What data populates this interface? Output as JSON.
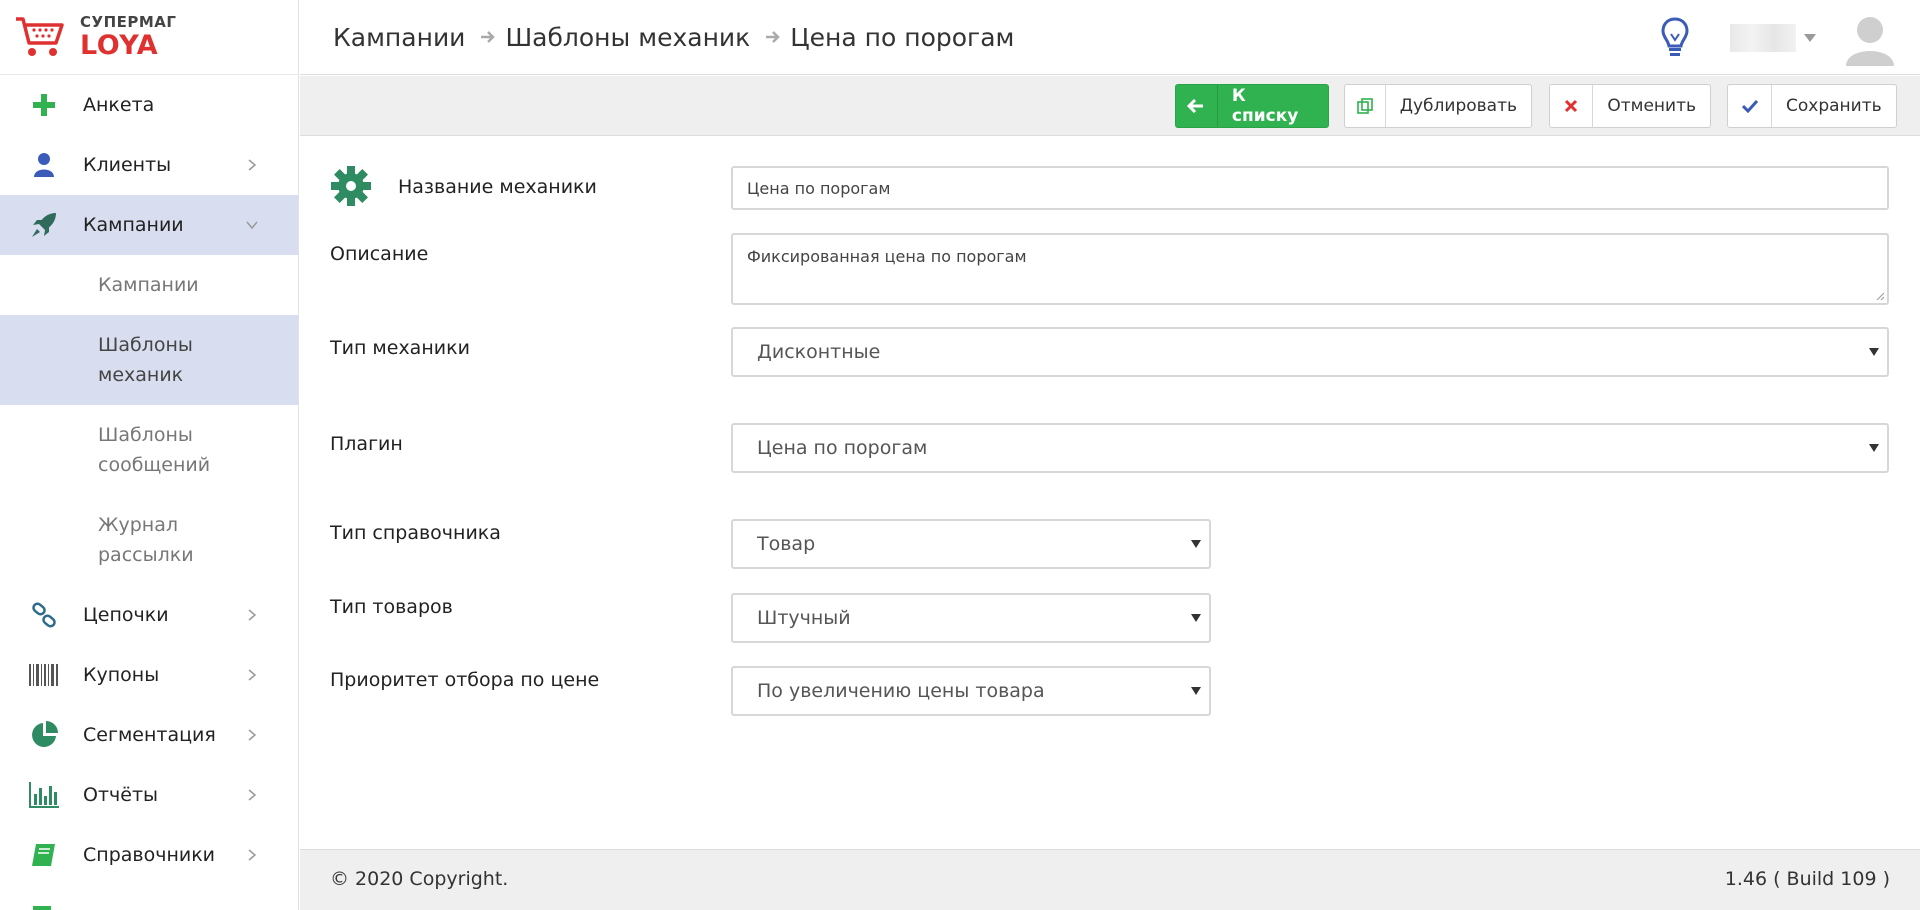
{
  "brand": {
    "top": "СУПЕРМАГ",
    "bottom": "LOYA"
  },
  "colors": {
    "accent_green": "#2fb24f",
    "active_nav": "#d8deef",
    "logo_red": "#e03131",
    "icon_teal": "#2e8b62",
    "icon_blue": "#3a5bb8"
  },
  "sidebar": {
    "items": [
      {
        "label": "Анкета",
        "icon": "plus-icon"
      },
      {
        "label": "Клиенты",
        "icon": "user-icon"
      },
      {
        "label": "Кампании",
        "icon": "rocket-icon"
      },
      {
        "label": "Цепочки",
        "icon": "chain-icon"
      },
      {
        "label": "Купоны",
        "icon": "barcode-icon"
      },
      {
        "label": "Сегментация",
        "icon": "pie-chart-icon"
      },
      {
        "label": "Отчёты",
        "icon": "bar-chart-icon"
      },
      {
        "label": "Справочники",
        "icon": "book-icon"
      }
    ],
    "sub_items": [
      {
        "label": "Кампании"
      },
      {
        "line1": "Шаблоны",
        "line2": "механик"
      },
      {
        "line1": "Шаблоны",
        "line2": "сообщений"
      },
      {
        "line1": "Журнал",
        "line2": "рассылки"
      }
    ]
  },
  "breadcrumb": [
    "Кампании",
    "Шаблоны механик",
    "Цена по порогам"
  ],
  "toolbar": {
    "back_label": "К списку",
    "duplicate_label": "Дублировать",
    "cancel_label": "Отменить",
    "save_label": "Сохранить"
  },
  "form": {
    "name_label": "Название механики",
    "name_value": "Цена по порогам",
    "description_label": "Описание",
    "description_value": "Фиксированная цена по порогам",
    "type_label": "Тип механики",
    "type_value": "Дисконтные",
    "plugin_label": "Плагин",
    "plugin_value": "Цена по порогам",
    "dict_type_label": "Тип справочника",
    "dict_type_value": "Товар",
    "goods_type_label": "Тип товаров",
    "goods_type_value": "Штучный",
    "priority_label": "Приоритет отбора по цене",
    "priority_value": "По увеличению цены товара"
  },
  "footer": {
    "copyright": "© 2020 Copyright.",
    "version": "1.46 ( Build 109 )"
  }
}
